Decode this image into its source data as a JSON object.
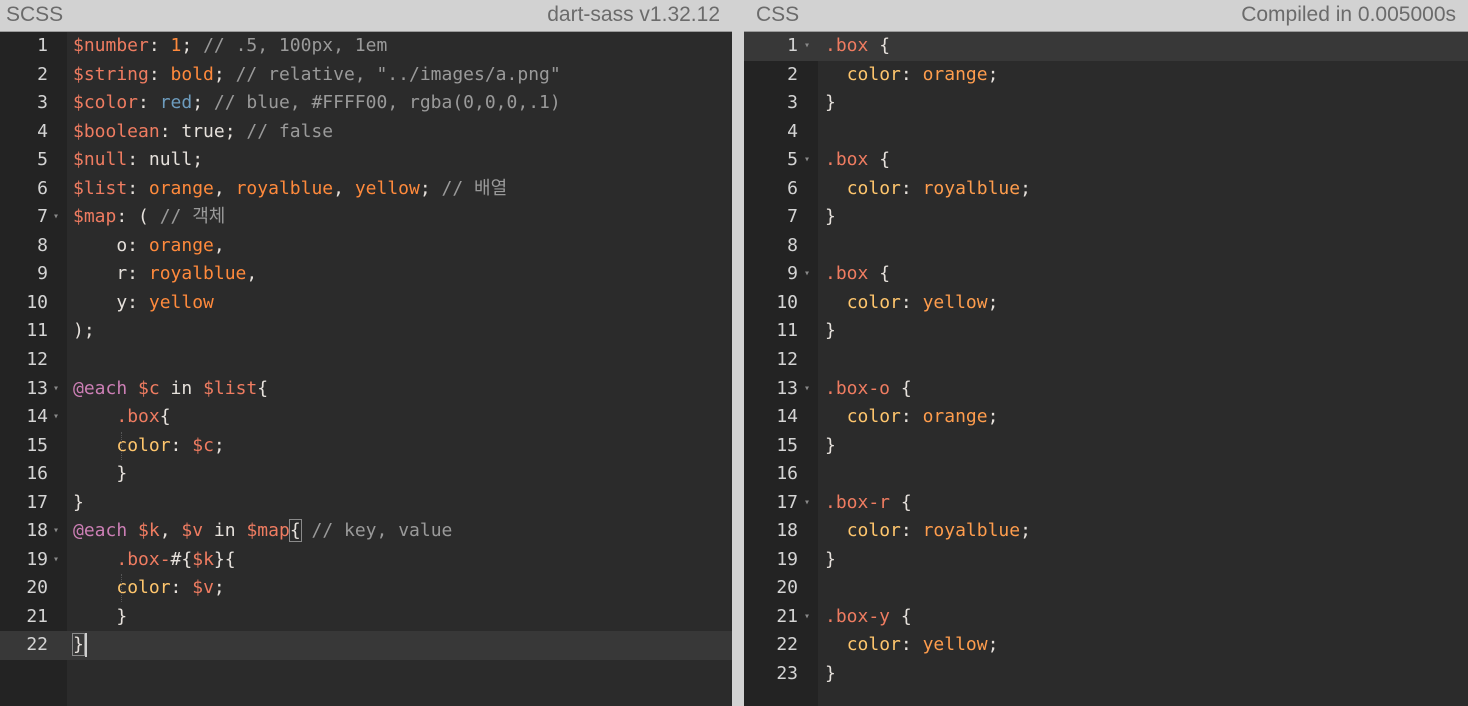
{
  "left": {
    "title": "SCSS",
    "version": "dart-sass v1.32.12",
    "lines": [
      {
        "n": "1",
        "tokens": [
          [
            "var",
            "$number"
          ],
          [
            "plain",
            ": "
          ],
          [
            "num",
            "1"
          ],
          [
            "plain",
            "; "
          ],
          [
            "com",
            "// .5, 100px, 1em"
          ]
        ]
      },
      {
        "n": "2",
        "tokens": [
          [
            "var",
            "$string"
          ],
          [
            "plain",
            ": "
          ],
          [
            "kw",
            "bold"
          ],
          [
            "plain",
            "; "
          ],
          [
            "com",
            "// relative, \"../images/a.png\""
          ]
        ]
      },
      {
        "n": "3",
        "tokens": [
          [
            "var",
            "$color"
          ],
          [
            "plain",
            ": "
          ],
          [
            "blue",
            "red"
          ],
          [
            "plain",
            "; "
          ],
          [
            "com",
            "// blue, #FFFF00, rgba(0,0,0,.1)"
          ]
        ]
      },
      {
        "n": "4",
        "tokens": [
          [
            "var",
            "$boolean"
          ],
          [
            "plain",
            ": true; "
          ],
          [
            "com",
            "// false"
          ]
        ]
      },
      {
        "n": "5",
        "tokens": [
          [
            "var",
            "$null"
          ],
          [
            "plain",
            ": null;"
          ]
        ]
      },
      {
        "n": "6",
        "tokens": [
          [
            "var",
            "$list"
          ],
          [
            "plain",
            ": "
          ],
          [
            "kw",
            "orange"
          ],
          [
            "plain",
            ", "
          ],
          [
            "kw",
            "royalblue"
          ],
          [
            "plain",
            ", "
          ],
          [
            "kw",
            "yellow"
          ],
          [
            "plain",
            "; "
          ],
          [
            "com",
            "// 배열"
          ]
        ]
      },
      {
        "n": "7",
        "fold": true,
        "tokens": [
          [
            "var",
            "$map"
          ],
          [
            "plain",
            ": ( "
          ],
          [
            "com",
            "// 객체"
          ]
        ]
      },
      {
        "n": "8",
        "tokens": [
          [
            "plain",
            "    o: "
          ],
          [
            "kw",
            "orange"
          ],
          [
            "plain",
            ","
          ]
        ]
      },
      {
        "n": "9",
        "tokens": [
          [
            "plain",
            "    r: "
          ],
          [
            "kw",
            "royalblue"
          ],
          [
            "plain",
            ","
          ]
        ]
      },
      {
        "n": "10",
        "tokens": [
          [
            "plain",
            "    y: "
          ],
          [
            "kw",
            "yellow"
          ]
        ]
      },
      {
        "n": "11",
        "tokens": [
          [
            "plain",
            ");"
          ]
        ]
      },
      {
        "n": "12",
        "tokens": []
      },
      {
        "n": "13",
        "fold": true,
        "tokens": [
          [
            "at",
            "@each"
          ],
          [
            "plain",
            " "
          ],
          [
            "var",
            "$c"
          ],
          [
            "plain",
            " in "
          ],
          [
            "var",
            "$list"
          ],
          [
            "plain",
            "{"
          ]
        ]
      },
      {
        "n": "14",
        "fold": true,
        "tokens": [
          [
            "plain",
            "    "
          ],
          [
            "sel",
            ".box"
          ],
          [
            "plain",
            "{"
          ]
        ]
      },
      {
        "n": "15",
        "tokens": [
          [
            "guide",
            ""
          ],
          [
            "plain",
            "    "
          ],
          [
            "prop",
            "color"
          ],
          [
            "plain",
            ": "
          ],
          [
            "var",
            "$c"
          ],
          [
            "plain",
            ";"
          ]
        ]
      },
      {
        "n": "16",
        "tokens": [
          [
            "plain",
            "    }"
          ]
        ]
      },
      {
        "n": "17",
        "tokens": [
          [
            "plain",
            "}"
          ]
        ]
      },
      {
        "n": "18",
        "fold": true,
        "tokens": [
          [
            "at",
            "@each"
          ],
          [
            "plain",
            " "
          ],
          [
            "var",
            "$k"
          ],
          [
            "plain",
            ", "
          ],
          [
            "var",
            "$v"
          ],
          [
            "plain",
            " in "
          ],
          [
            "var",
            "$map"
          ],
          [
            "hl",
            "{"
          ],
          [
            "plain",
            " "
          ],
          [
            "com",
            "// key, value"
          ]
        ]
      },
      {
        "n": "19",
        "fold": true,
        "tokens": [
          [
            "plain",
            "    "
          ],
          [
            "sel",
            ".box-"
          ],
          [
            "plain",
            "#{"
          ],
          [
            "var",
            "$k"
          ],
          [
            "plain",
            "}{"
          ]
        ]
      },
      {
        "n": "20",
        "tokens": [
          [
            "guide",
            ""
          ],
          [
            "plain",
            "    "
          ],
          [
            "prop",
            "color"
          ],
          [
            "plain",
            ": "
          ],
          [
            "var",
            "$v"
          ],
          [
            "plain",
            ";"
          ]
        ]
      },
      {
        "n": "21",
        "tokens": [
          [
            "plain",
            "    }"
          ]
        ]
      },
      {
        "n": "22",
        "active": true,
        "tokens": [
          [
            "hl",
            "}"
          ],
          [
            "cursor",
            ""
          ]
        ]
      }
    ]
  },
  "right": {
    "title": "CSS",
    "status": "Compiled in 0.005000s",
    "lines": [
      {
        "n": "1",
        "fold": true,
        "active": true,
        "tokens": [
          [
            "sel",
            ".box"
          ],
          [
            "plain",
            " {"
          ]
        ]
      },
      {
        "n": "2",
        "tokens": [
          [
            "plain",
            "  "
          ],
          [
            "prop",
            "color"
          ],
          [
            "plain",
            ": "
          ],
          [
            "val",
            "orange"
          ],
          [
            "plain",
            ";"
          ]
        ]
      },
      {
        "n": "3",
        "tokens": [
          [
            "plain",
            "}"
          ]
        ]
      },
      {
        "n": "4",
        "tokens": []
      },
      {
        "n": "5",
        "fold": true,
        "tokens": [
          [
            "sel",
            ".box"
          ],
          [
            "plain",
            " {"
          ]
        ]
      },
      {
        "n": "6",
        "tokens": [
          [
            "plain",
            "  "
          ],
          [
            "prop",
            "color"
          ],
          [
            "plain",
            ": "
          ],
          [
            "val",
            "royalblue"
          ],
          [
            "plain",
            ";"
          ]
        ]
      },
      {
        "n": "7",
        "tokens": [
          [
            "plain",
            "}"
          ]
        ]
      },
      {
        "n": "8",
        "tokens": []
      },
      {
        "n": "9",
        "fold": true,
        "tokens": [
          [
            "sel",
            ".box"
          ],
          [
            "plain",
            " {"
          ]
        ]
      },
      {
        "n": "10",
        "tokens": [
          [
            "plain",
            "  "
          ],
          [
            "prop",
            "color"
          ],
          [
            "plain",
            ": "
          ],
          [
            "val",
            "yellow"
          ],
          [
            "plain",
            ";"
          ]
        ]
      },
      {
        "n": "11",
        "tokens": [
          [
            "plain",
            "}"
          ]
        ]
      },
      {
        "n": "12",
        "tokens": []
      },
      {
        "n": "13",
        "fold": true,
        "tokens": [
          [
            "sel",
            ".box-o"
          ],
          [
            "plain",
            " {"
          ]
        ]
      },
      {
        "n": "14",
        "tokens": [
          [
            "plain",
            "  "
          ],
          [
            "prop",
            "color"
          ],
          [
            "plain",
            ": "
          ],
          [
            "val",
            "orange"
          ],
          [
            "plain",
            ";"
          ]
        ]
      },
      {
        "n": "15",
        "tokens": [
          [
            "plain",
            "}"
          ]
        ]
      },
      {
        "n": "16",
        "tokens": []
      },
      {
        "n": "17",
        "fold": true,
        "tokens": [
          [
            "sel",
            ".box-r"
          ],
          [
            "plain",
            " {"
          ]
        ]
      },
      {
        "n": "18",
        "tokens": [
          [
            "plain",
            "  "
          ],
          [
            "prop",
            "color"
          ],
          [
            "plain",
            ": "
          ],
          [
            "val",
            "royalblue"
          ],
          [
            "plain",
            ";"
          ]
        ]
      },
      {
        "n": "19",
        "tokens": [
          [
            "plain",
            "}"
          ]
        ]
      },
      {
        "n": "20",
        "tokens": []
      },
      {
        "n": "21",
        "fold": true,
        "tokens": [
          [
            "sel",
            ".box-y"
          ],
          [
            "plain",
            " {"
          ]
        ]
      },
      {
        "n": "22",
        "tokens": [
          [
            "plain",
            "  "
          ],
          [
            "prop",
            "color"
          ],
          [
            "plain",
            ": "
          ],
          [
            "val",
            "yellow"
          ],
          [
            "plain",
            ";"
          ]
        ]
      },
      {
        "n": "23",
        "tokens": [
          [
            "plain",
            "}"
          ]
        ]
      }
    ]
  }
}
